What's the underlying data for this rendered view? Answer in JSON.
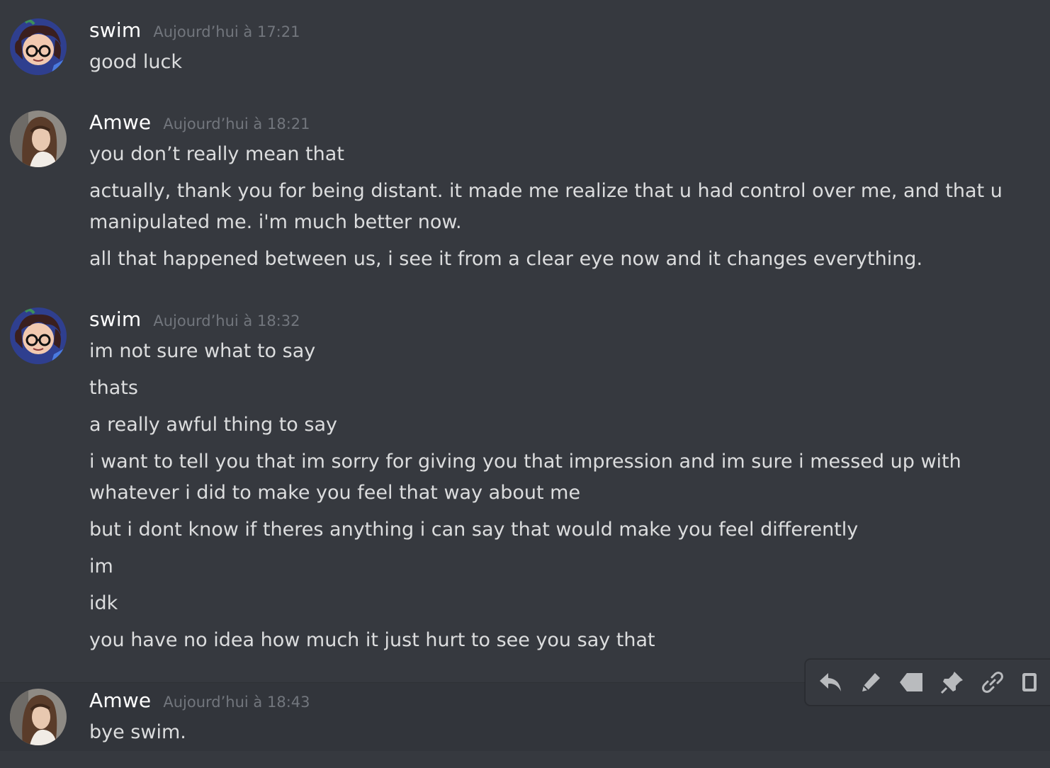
{
  "messages": [
    {
      "author": "swim",
      "timestamp": "Aujourd’hui à 17:21",
      "lines": [
        "good luck"
      ]
    },
    {
      "author": "Amwe",
      "timestamp": "Aujourd’hui à 18:21",
      "lines": [
        "you don’t really mean that",
        "actually, thank you for being distant. it made me realize that u had control over me, and that u manipulated me. i'm much better now.",
        "all that happened between us, i see it from a clear eye now and it changes everything."
      ]
    },
    {
      "author": "swim",
      "timestamp": "Aujourd’hui à 18:32",
      "lines": [
        "im not sure what to say",
        "thats",
        "a really awful thing to say",
        "i want to tell you that im sorry for giving you that impression and im sure i messed up with whatever i did to make you feel that way about me",
        "but i dont know if theres anything i can say that would make you feel differently",
        "im",
        "idk",
        "you have no idea how much it just hurt to see you say that"
      ]
    },
    {
      "author": "Amwe",
      "timestamp": "Aujourd’hui à 18:43",
      "lines": [
        "bye swim."
      ]
    }
  ],
  "toolbar": {
    "icons": [
      "reply-icon",
      "edit-icon",
      "tag-icon",
      "pin-icon",
      "link-icon",
      "more-icon"
    ]
  },
  "colors": {
    "background": "#36393f",
    "hover_background": "#32353b",
    "username": "#ffffff",
    "timestamp": "#72767d",
    "message_text": "#dcddde",
    "icon": "#b9bbbe"
  }
}
